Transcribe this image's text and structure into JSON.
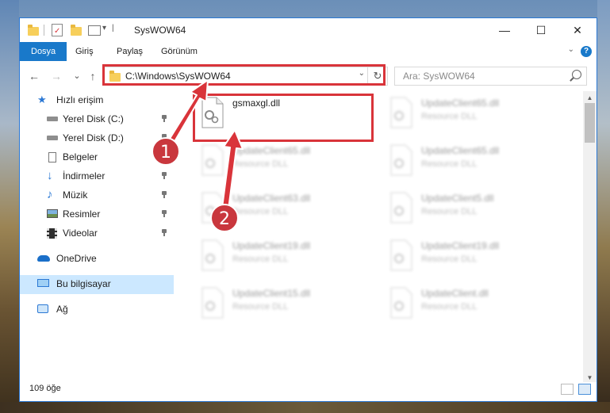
{
  "window": {
    "title": "SysWOW64",
    "controls": {
      "minimize": "—",
      "maximize": "☐",
      "close": "✕"
    }
  },
  "ribbon": {
    "tabs": [
      {
        "label": "Dosya",
        "active": true
      },
      {
        "label": "Giriş",
        "active": false
      },
      {
        "label": "Paylaş",
        "active": false
      },
      {
        "label": "Görünüm",
        "active": false
      }
    ],
    "help": "?"
  },
  "navigation": {
    "back": "←",
    "forward": "→",
    "recent": "⌄",
    "up": "↑",
    "address": "C:\\Windows\\SysWOW64",
    "refresh": "↻",
    "search_placeholder": "Ara: SysWOW64"
  },
  "sidebar": {
    "items": [
      {
        "label": "Hızlı erişim",
        "icon": "star-icon",
        "pinned": false,
        "selected": false
      },
      {
        "label": "Yerel Disk (C:)",
        "icon": "drive-icon",
        "pinned": true,
        "selected": false
      },
      {
        "label": "Yerel Disk (D:)",
        "icon": "drive-icon",
        "pinned": true,
        "selected": false
      },
      {
        "label": "Belgeler",
        "icon": "documents-icon",
        "pinned": true,
        "selected": false
      },
      {
        "label": "İndirmeler",
        "icon": "download-icon",
        "pinned": true,
        "selected": false
      },
      {
        "label": "Müzik",
        "icon": "music-icon",
        "pinned": true,
        "selected": false
      },
      {
        "label": "Resimler",
        "icon": "pictures-icon",
        "pinned": true,
        "selected": false
      },
      {
        "label": "Videolar",
        "icon": "videos-icon",
        "pinned": true,
        "selected": false
      },
      {
        "label": "OneDrive",
        "icon": "cloud-icon",
        "pinned": false,
        "selected": false
      },
      {
        "label": "Bu bilgisayar",
        "icon": "computer-icon",
        "pinned": false,
        "selected": true
      },
      {
        "label": "Ağ",
        "icon": "network-icon",
        "pinned": false,
        "selected": false
      }
    ]
  },
  "files": [
    {
      "name": "gsmaxgl.dll",
      "type": "",
      "highlighted": true
    },
    {
      "name": "UpdateClient65.dll",
      "type": "Resource DLL",
      "highlighted": false
    },
    {
      "name": "UpdateClient65.dll",
      "type": "Resource DLL",
      "highlighted": false
    },
    {
      "name": "UpdateClient65.dll",
      "type": "Resource DLL",
      "highlighted": false
    },
    {
      "name": "UpdateClient63.dll",
      "type": "Resource DLL",
      "highlighted": false
    },
    {
      "name": "UpdateClient5.dll",
      "type": "Resource DLL",
      "highlighted": false
    },
    {
      "name": "UpdateClient19.dll",
      "type": "Resource DLL",
      "highlighted": false
    },
    {
      "name": "UpdateClient19.dll",
      "type": "Resource DLL",
      "highlighted": false
    },
    {
      "name": "UpdateClient15.dll",
      "type": "Resource DLL",
      "highlighted": false
    },
    {
      "name": "UpdateClient.dll",
      "type": "Resource DLL",
      "highlighted": false
    }
  ],
  "status": {
    "item_count": "109 öğe"
  },
  "annotations": [
    {
      "label": "1",
      "color": "#c9373d"
    },
    {
      "label": "2",
      "color": "#c9373d"
    }
  ]
}
